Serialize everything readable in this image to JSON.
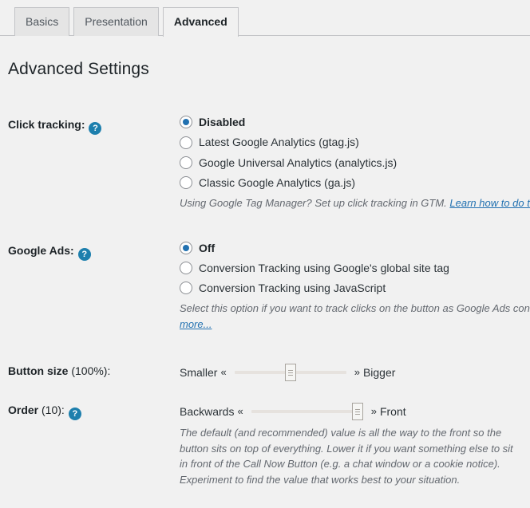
{
  "tabs": [
    {
      "label": "Basics",
      "active": false
    },
    {
      "label": "Presentation",
      "active": false
    },
    {
      "label": "Advanced",
      "active": true
    }
  ],
  "page": {
    "title": "Advanced Settings"
  },
  "help_icon_glyph": "?",
  "settings": {
    "click_tracking": {
      "label": "Click tracking:",
      "has_help": true,
      "options": [
        {
          "label": "Disabled",
          "checked": true
        },
        {
          "label": "Latest Google Analytics (gtag.js)",
          "checked": false
        },
        {
          "label": "Google Universal Analytics (analytics.js)",
          "checked": false
        },
        {
          "label": "Classic Google Analytics (ga.js)",
          "checked": false
        }
      ],
      "description_text": "Using Google Tag Manager? Set up click tracking in GTM. ",
      "description_link": "Learn how to do this..."
    },
    "google_ads": {
      "label": "Google Ads:",
      "has_help": true,
      "options": [
        {
          "label": "Off",
          "checked": true
        },
        {
          "label": "Conversion Tracking using Google's global site tag",
          "checked": false
        },
        {
          "label": "Conversion Tracking using JavaScript",
          "checked": false
        }
      ],
      "description_text": "Select this option if you want to track clicks on the button as Google Ads conversions. ",
      "description_link": "more..."
    },
    "button_size": {
      "label_bold": "Button size",
      "label_value": " (100%):",
      "has_help": false,
      "min_label": "Smaller",
      "max_label": "Bigger",
      "left_arrow": "«",
      "right_arrow": "»",
      "value_percent": 50
    },
    "order": {
      "label_bold": "Order",
      "label_value": " (10):",
      "has_help": true,
      "min_label": "Backwards",
      "max_label": "Front",
      "left_arrow": "«",
      "right_arrow": "»",
      "value_percent": 100,
      "description": "The default (and recommended) value is all the way to the front so the button sits on top of everything. Lower it if you want something else to sit in front of the Call Now Button (e.g. a chat window or a cookie notice). Experiment to find the value that works best to your situation."
    }
  }
}
